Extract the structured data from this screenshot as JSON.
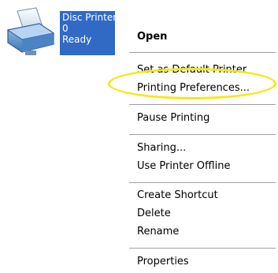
{
  "printer": {
    "icon": "printer-icon",
    "name": "Disc Printer",
    "documents": "0",
    "status": "Ready"
  },
  "menu": {
    "items": [
      {
        "label": "Open"
      },
      {
        "label": "Set as Default Printer"
      },
      {
        "label": "Printing Preferences..."
      },
      {
        "label": "Pause Printing"
      },
      {
        "label": "Sharing..."
      },
      {
        "label": "Use Printer Offline"
      },
      {
        "label": "Create Shortcut"
      },
      {
        "label": "Delete"
      },
      {
        "label": "Rename"
      },
      {
        "label": "Properties"
      }
    ]
  },
  "colors": {
    "selection": "#316ac5",
    "highlight_ring": "#f5e81a"
  }
}
